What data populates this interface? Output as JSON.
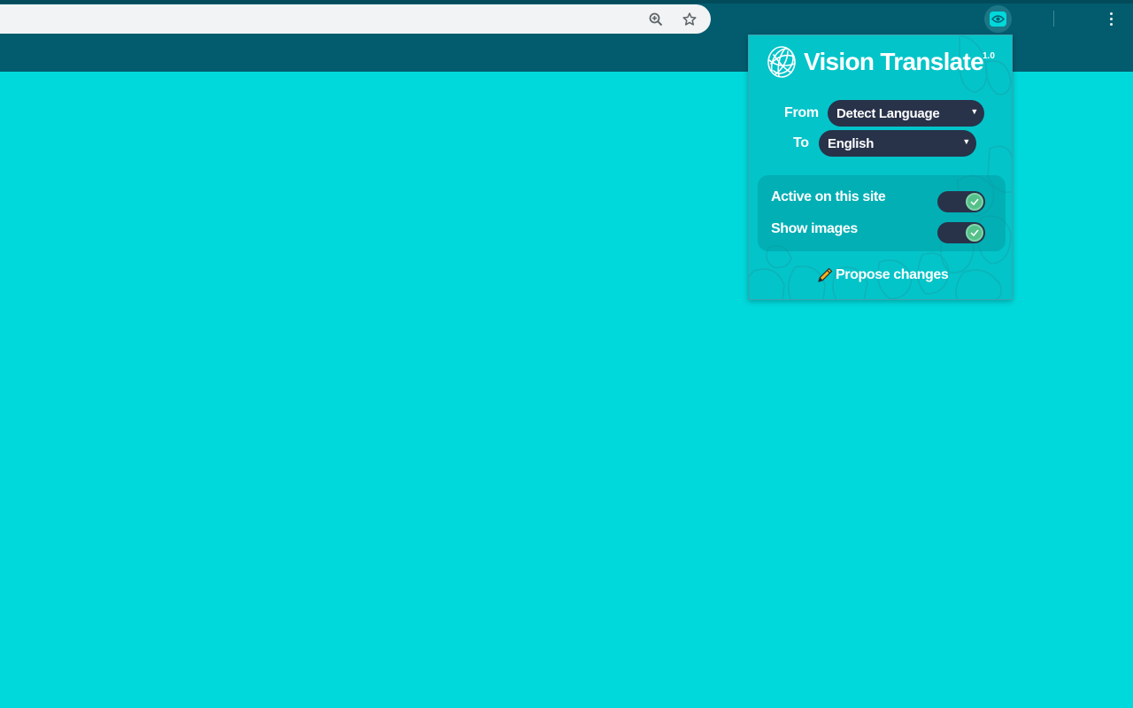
{
  "browser": {
    "toolbar": {
      "zoom_icon": "zoom-in-icon",
      "bookmark_icon": "star-icon",
      "extension_icon": "eye-icon",
      "menu_icon": "more-vert-icon"
    }
  },
  "popup": {
    "title": "Vision Translate",
    "version": "1.0",
    "from_label": "From",
    "from_value": "Detect Language",
    "to_label": "To",
    "to_value": "English",
    "settings": [
      {
        "label": "Active on this site",
        "enabled": true
      },
      {
        "label": "Show images",
        "enabled": true
      }
    ],
    "propose_label": "Propose changes",
    "propose_icon": "pencil-icon"
  },
  "colors": {
    "page_background": "#00d9db",
    "chrome": "#035c6e",
    "popup_background": "#03c4c9",
    "select_background": "#283249",
    "toggle_on": "#55c18a"
  }
}
